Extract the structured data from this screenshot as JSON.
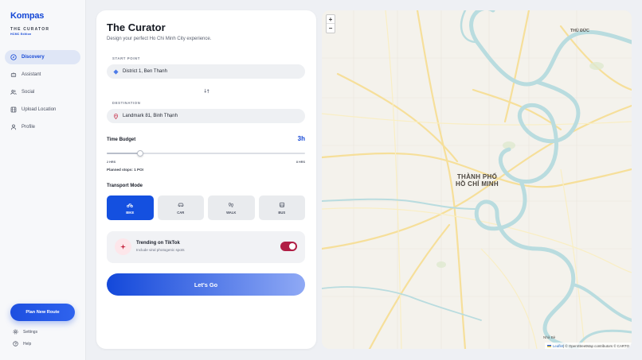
{
  "sidebar": {
    "brand": "Kompas",
    "subtitle": "THE CURATOR",
    "edition": "HCMC Edition",
    "nav": [
      {
        "label": "Discovery",
        "icon": "compass-icon",
        "active": true
      },
      {
        "label": "Assistant",
        "icon": "robot-icon",
        "active": false
      },
      {
        "label": "Social",
        "icon": "users-icon",
        "active": false
      },
      {
        "label": "Upload Location",
        "icon": "film-icon",
        "active": false
      },
      {
        "label": "Profile",
        "icon": "person-icon",
        "active": false
      }
    ],
    "plan_button": "Plan New Route",
    "footer": {
      "settings": "Settings",
      "help": "Help"
    }
  },
  "panel": {
    "title": "The Curator",
    "subtitle": "Design your perfect Ho Chi Minh City experience.",
    "start_label": "START POINT",
    "start_value": "District 1, Ben Thanh",
    "destination_label": "DESTINATION",
    "destination_value": "Landmark 81, Binh Thạnh",
    "budget": {
      "title": "Time Budget",
      "value": "3h",
      "min_label": "2 HRS",
      "max_label": "8 HRS",
      "min": 2,
      "max": 8,
      "current": 3
    },
    "planned_stops": "Planned stops: 1 POI",
    "transport": {
      "title": "Transport Mode",
      "modes": [
        {
          "label": "BIKE",
          "icon": "bike-icon",
          "active": true
        },
        {
          "label": "CAR",
          "icon": "car-icon",
          "active": false
        },
        {
          "label": "WALK",
          "icon": "walk-icon",
          "active": false
        },
        {
          "label": "BUS",
          "icon": "bus-icon",
          "active": false
        }
      ]
    },
    "trending": {
      "title": "Trending on TikTok",
      "subtitle": "Include viral photogenic spots",
      "enabled": true
    },
    "go_button": "Let's Go"
  },
  "map": {
    "zoom_in": "+",
    "zoom_out": "−",
    "district_label": "THỦ ĐỨC",
    "city_line1": "THÀNH PHỐ",
    "city_line2": "HỒ CHÍ MINH",
    "corner_label": "Nhà Bè",
    "attribution_leaflet": "Leaflet",
    "attribution_rest": " | © OpenStreetMap contributors © CARTO"
  },
  "colors": {
    "accent": "#1447d6",
    "toggle_on": "#b01e45",
    "river": "#b9dcdf"
  }
}
